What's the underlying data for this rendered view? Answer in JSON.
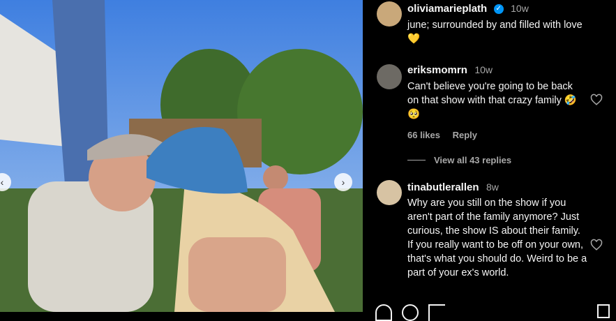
{
  "post": {
    "author": "oliviamarieplath",
    "time": "10w",
    "caption": "june; surrounded by and filled with love",
    "caption_emoji": "💛"
  },
  "comments": [
    {
      "username": "eriksmomrn",
      "time": "10w",
      "text": "Can't believe you're going to be back on that show with that crazy family 🤣 🥺",
      "likes": "66 likes",
      "reply_label": "Reply"
    },
    {
      "username": "tinabutlerallen",
      "time": "8w",
      "text": "Why are you still on the show if you aren't part of the family anymore? Just curious, the show IS about their family. If you really want to be off on your own, that's what you should do. Weird to be a part of your ex's world."
    }
  ],
  "view_replies": "View all 43 replies",
  "icons": {
    "prev": "chevron-left-icon",
    "next": "chevron-right-icon",
    "like": "heart-icon",
    "verified": "verified-badge-icon"
  },
  "colors": {
    "background": "#000000",
    "text": "#f5f5f5",
    "muted": "#a8a8a8",
    "verified": "#0095f6"
  }
}
